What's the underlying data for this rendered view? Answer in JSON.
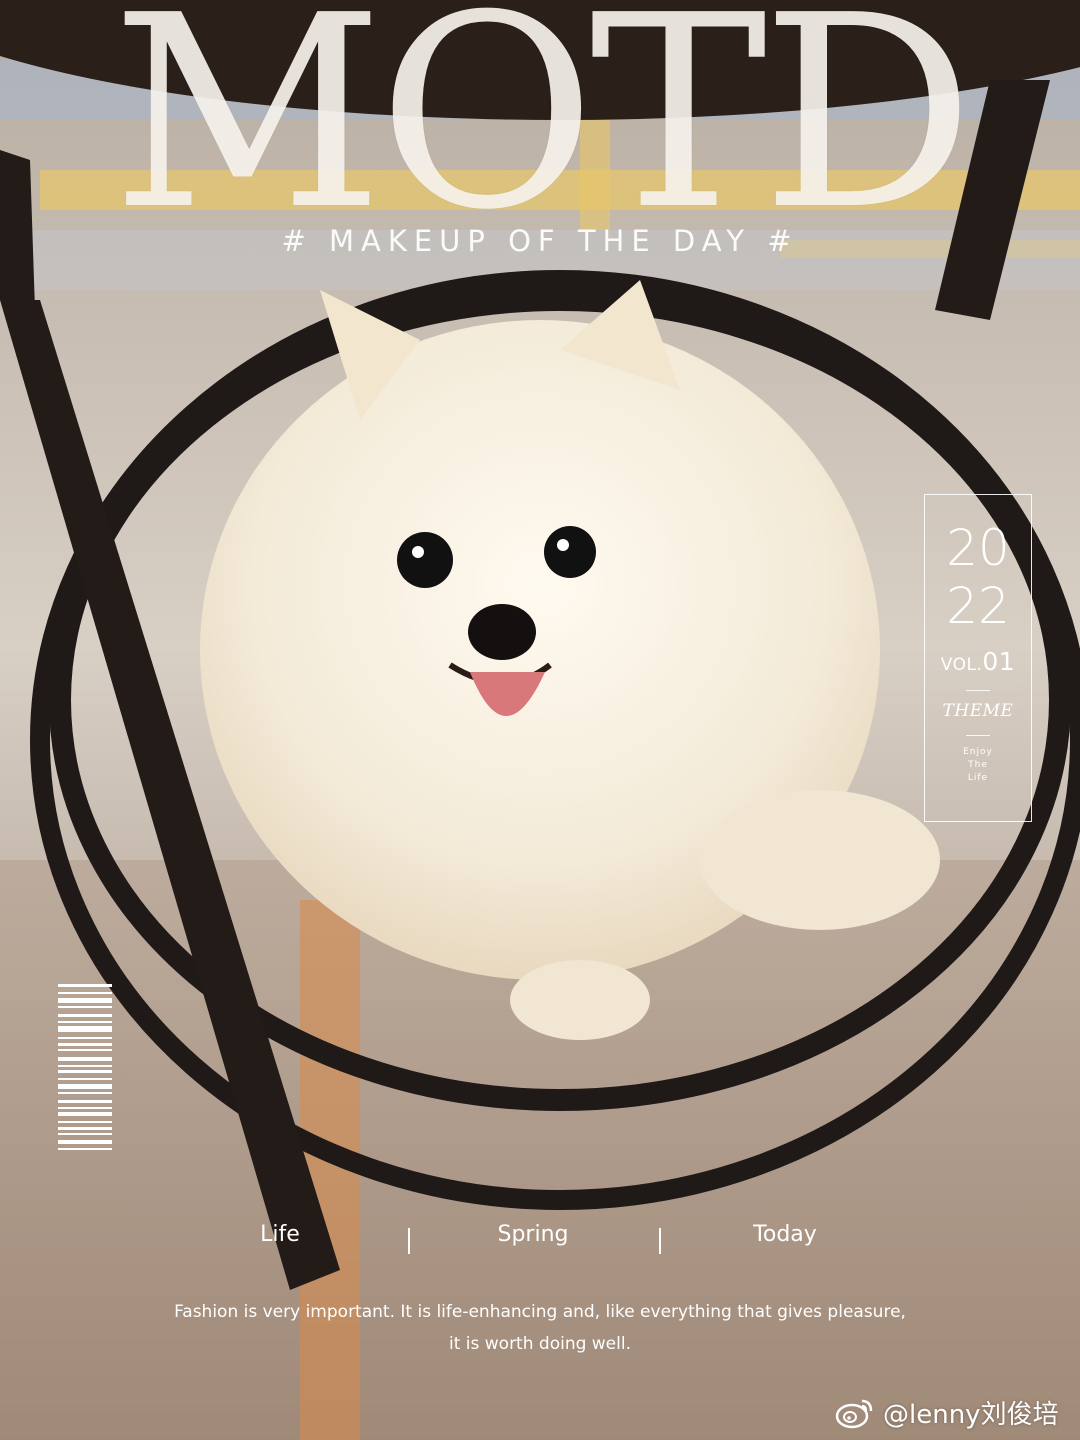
{
  "cover": {
    "masthead": "MOTD",
    "tagline": "# MAKEUP OF THE DAY #",
    "year_line_1": "20",
    "year_line_2": "22",
    "vol_prefix": "VOL.",
    "vol_number": "01",
    "theme_label": "THEME",
    "enjoy_line_1": "Enjoy",
    "enjoy_line_2": "The",
    "enjoy_line_3": "Life",
    "labels": [
      "Life",
      "Spring",
      "Today"
    ],
    "quote_line_1": "Fashion is very important. It is life-enhancing and, like everything that gives pleasure,",
    "quote_line_2": "it is worth doing well."
  },
  "watermark": {
    "icon": "weibo-icon",
    "handle": "@lenny刘俊培"
  },
  "colors": {
    "text_white": "#ffffff",
    "fur_white": "#f5efe3",
    "table_black": "#1f1a17",
    "rug_orange": "#d88b4a",
    "rug_blue": "#a7b6cb",
    "rug_yellow": "#e7c768"
  }
}
